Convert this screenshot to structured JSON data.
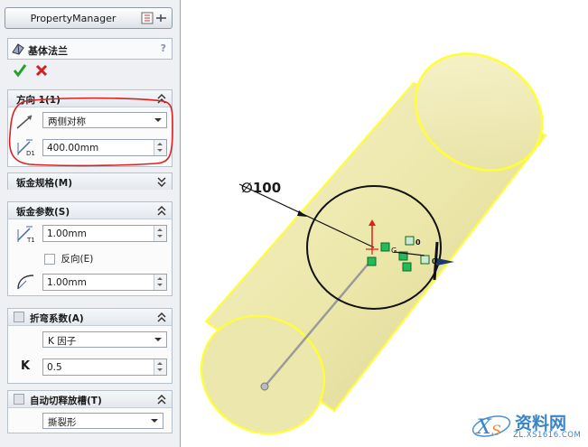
{
  "panel": {
    "title": "PropertyManager",
    "feature_name": "基体法兰",
    "help": "?"
  },
  "direction": {
    "header": "方向 1(1)",
    "end_condition": "两侧对称",
    "depth_label": "D1",
    "depth": "400.00mm"
  },
  "gauge": {
    "header": "钣金规格(M)"
  },
  "sheet_params": {
    "header": "钣金参数(S)",
    "thickness_label": "T1",
    "thickness": "1.00mm",
    "reverse_label": "反向(E)",
    "radius": "1.00mm"
  },
  "bend_allowance": {
    "header": "折弯系数(A)",
    "type": "K 因子",
    "k_label": "K",
    "k_value": "0.5"
  },
  "relief": {
    "header": "自动切释放槽(T)",
    "type": "撕裂形"
  },
  "viewport": {
    "dimension": "∅100",
    "relation_labels": [
      "0",
      "0"
    ],
    "relation_mid": "G"
  },
  "watermark": {
    "brand": "资料网",
    "url": "ZL.XS1616.COM"
  },
  "colors": {
    "cylinder": "#f0ecb0",
    "cylinder_edge": "#ffff33",
    "sketch": "#000000",
    "relation": "#22bb55",
    "highlight": "#e02020"
  }
}
